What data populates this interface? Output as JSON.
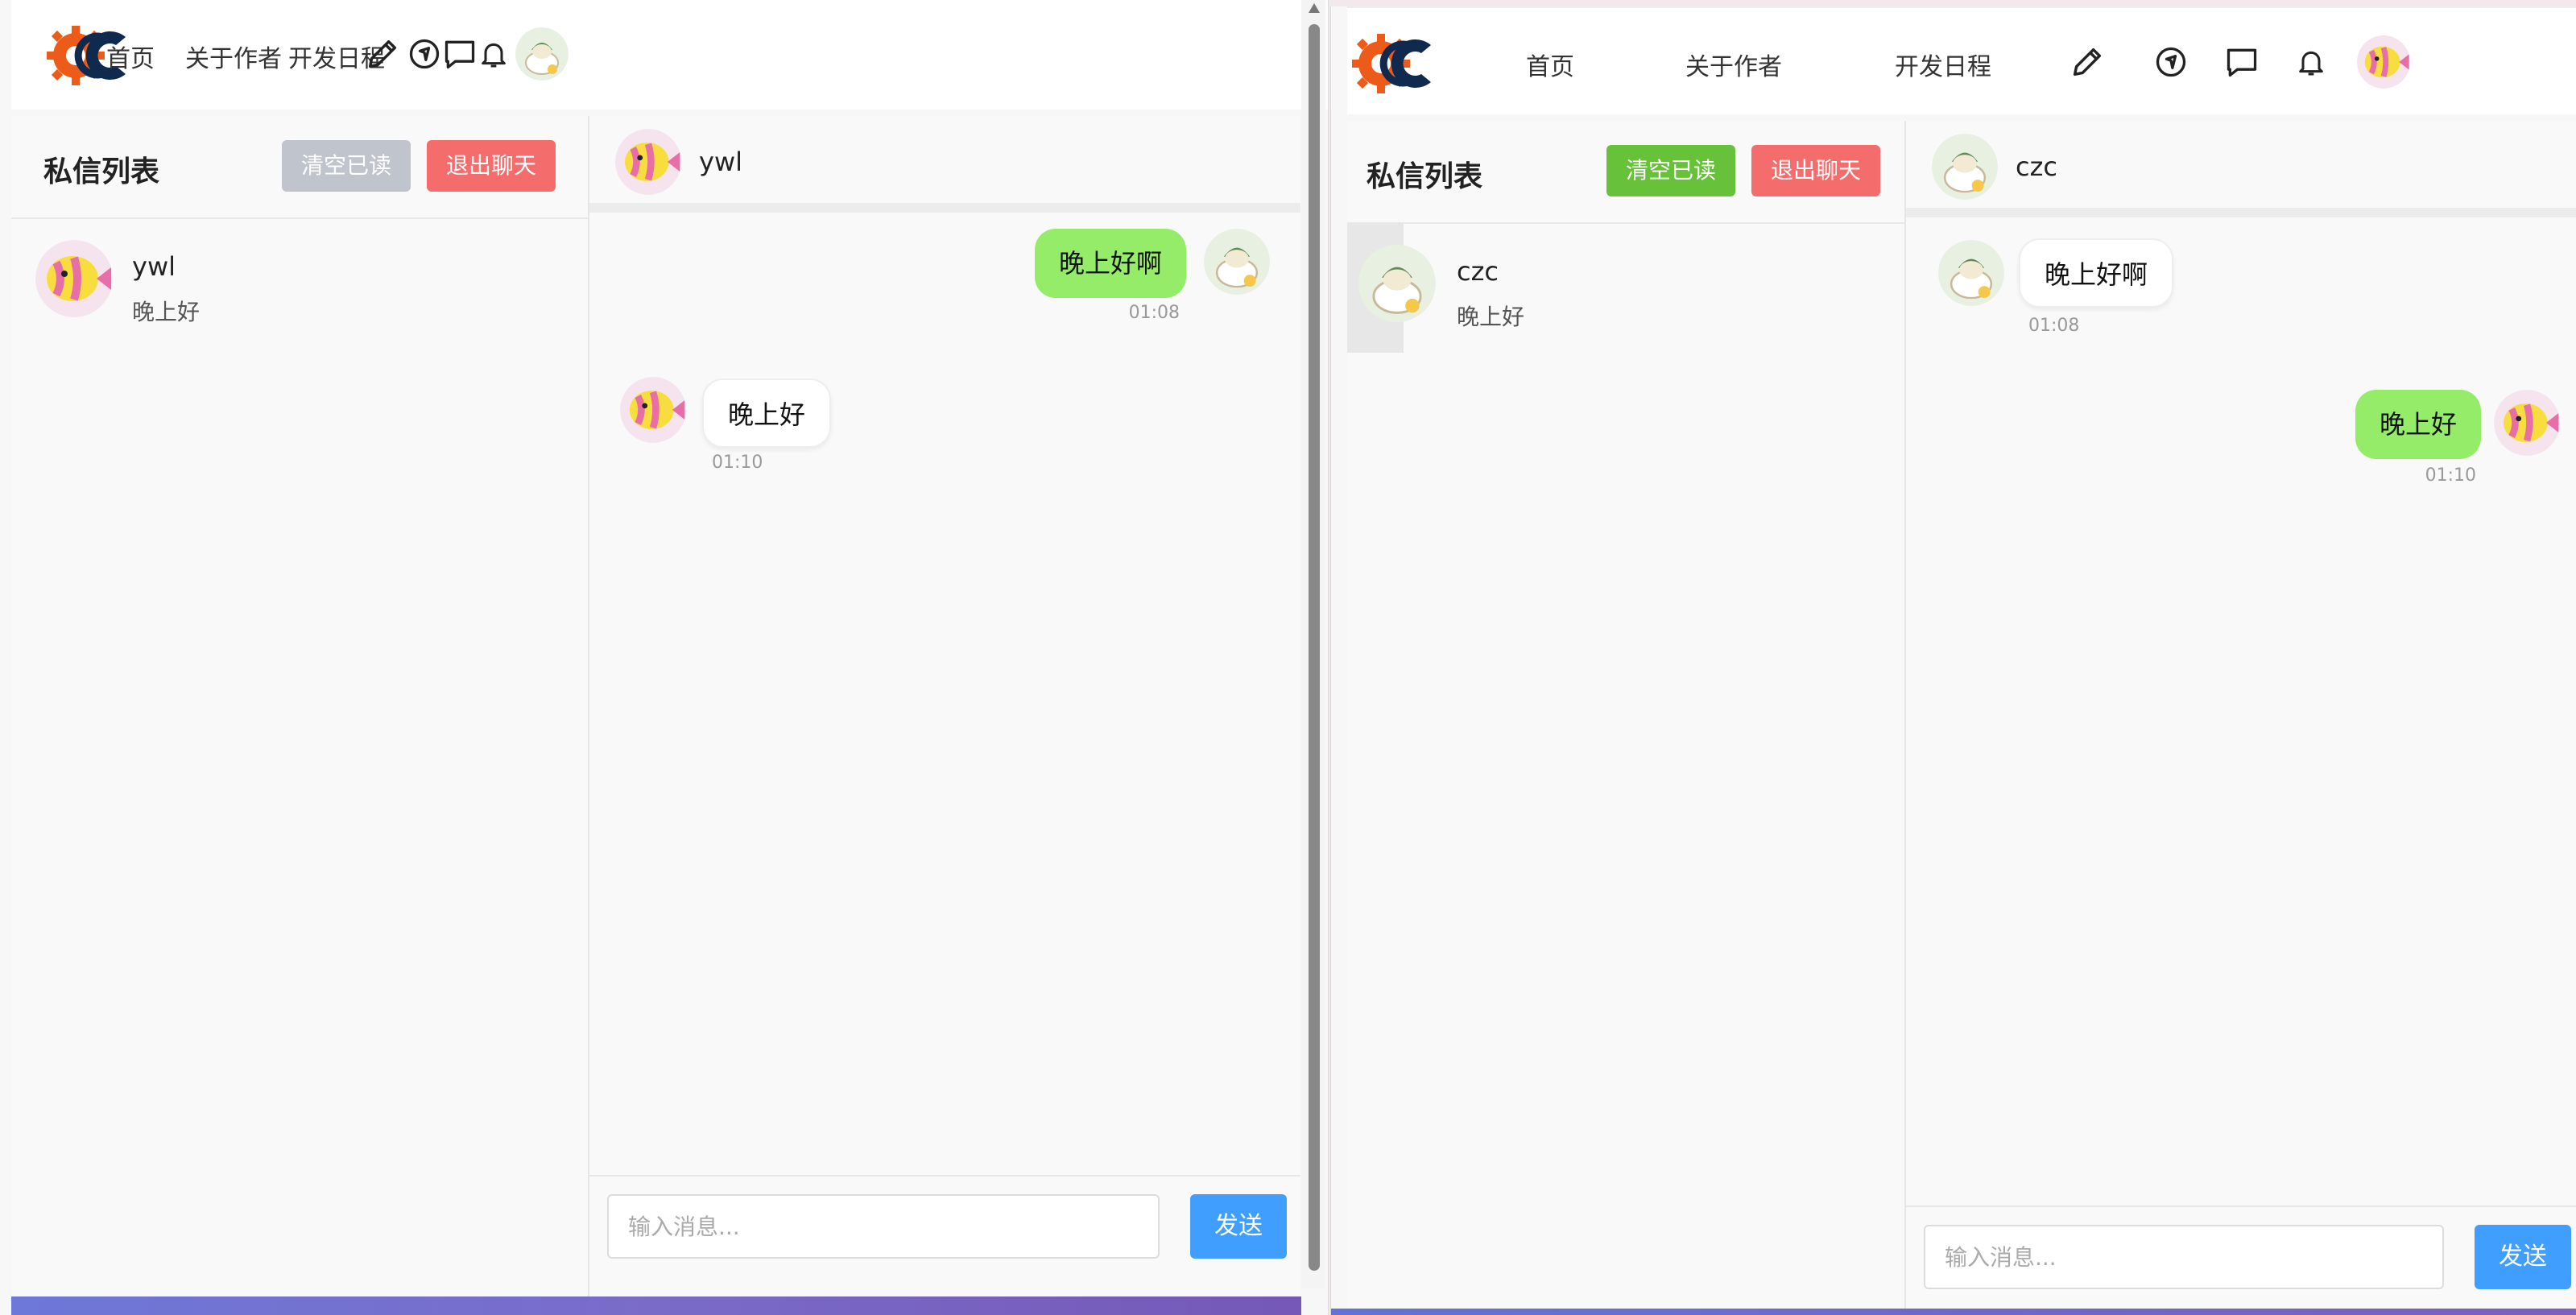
{
  "colors": {
    "accent": "#409eff",
    "danger": "#f56c6c",
    "success": "#67c23a",
    "disabled": "#c0c4cc",
    "my_bubble": "#95ec69"
  },
  "left_window": {
    "nav": {
      "links": [
        "首页",
        "关于作者",
        "开发日程"
      ],
      "icons": [
        "pencil-icon",
        "compass-icon",
        "chat-bubble-icon",
        "bell-icon"
      ],
      "avatar": "sprout-avatar"
    },
    "list": {
      "title": "私信列表",
      "clear_label": "清空已读",
      "exit_label": "退出聊天",
      "items": [
        {
          "name": "ywl",
          "last": "晚上好",
          "avatar": "fish-avatar"
        }
      ]
    },
    "chat": {
      "peer_name": "ywl",
      "messages": [
        {
          "from": "me",
          "text": "晚上好啊",
          "time": "01:08"
        },
        {
          "from": "peer",
          "text": "晚上好",
          "time": "01:10"
        }
      ],
      "input_placeholder": "输入消息...",
      "send_label": "发送"
    }
  },
  "right_window": {
    "nav": {
      "links": [
        "首页",
        "关于作者",
        "开发日程"
      ],
      "icons": [
        "pencil-icon",
        "compass-icon",
        "chat-bubble-icon",
        "bell-icon"
      ],
      "avatar": "fish-avatar"
    },
    "list": {
      "title": "私信列表",
      "clear_label": "清空已读",
      "exit_label": "退出聊天",
      "items": [
        {
          "name": "czc",
          "last": "晚上好",
          "avatar": "sprout-avatar"
        }
      ]
    },
    "chat": {
      "peer_name": "czc",
      "messages": [
        {
          "from": "peer",
          "text": "晚上好啊",
          "time": "01:08"
        },
        {
          "from": "me",
          "text": "晚上好",
          "time": "01:10"
        }
      ],
      "input_placeholder": "输入消息...",
      "send_label": "发送"
    }
  }
}
